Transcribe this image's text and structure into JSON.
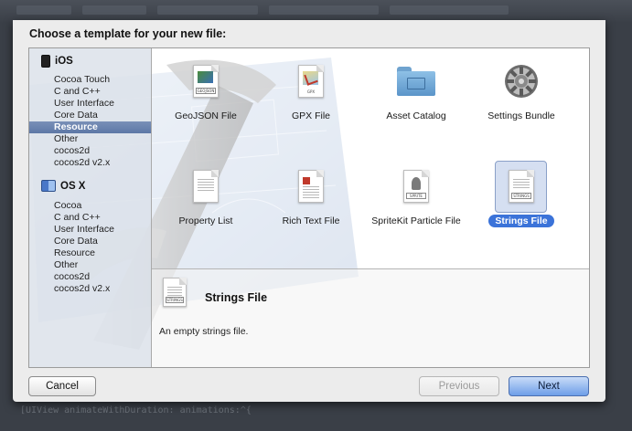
{
  "dialog": {
    "title": "Choose a template for your new file:"
  },
  "sidebar": {
    "sections": [
      {
        "label": "iOS",
        "icon": "iphone-icon",
        "items": [
          "Cocoa Touch",
          "C and C++",
          "User Interface",
          "Core Data",
          "Resource",
          "Other",
          "cocos2d",
          "cocos2d v2.x"
        ],
        "selected_index": 4
      },
      {
        "label": "OS X",
        "icon": "mac-os-icon",
        "items": [
          "Cocoa",
          "C and C++",
          "User Interface",
          "Core Data",
          "Resource",
          "Other",
          "cocos2d",
          "cocos2d v2.x"
        ]
      }
    ]
  },
  "templates": [
    {
      "label": "GeoJSON File",
      "icon": "geojson-file-icon",
      "tag": "GEOJSON"
    },
    {
      "label": "GPX File",
      "icon": "gpx-file-icon",
      "tag": "GPX"
    },
    {
      "label": "Asset Catalog",
      "icon": "folder-icon"
    },
    {
      "label": "Settings Bundle",
      "icon": "settings-gear-icon"
    },
    {
      "label": "Property List",
      "icon": "property-list-icon"
    },
    {
      "label": "Rich Text File",
      "icon": "rich-text-file-icon"
    },
    {
      "label": "SpriteKit Particle File",
      "icon": "spritekit-particle-icon",
      "tag": "SPRITE"
    },
    {
      "label": "Strings File",
      "icon": "strings-file-icon",
      "tag": "STRINGS",
      "selected": true
    }
  ],
  "detail": {
    "title": "Strings File",
    "description": "An empty strings file.",
    "icon": "strings-file-icon",
    "tag": "STRINGS"
  },
  "buttons": {
    "cancel": "Cancel",
    "previous": "Previous",
    "next": "Next"
  },
  "colors": {
    "selection": "#5d77a6",
    "selected_label": "#3b73d9",
    "primary_button": "#6e9ee8"
  }
}
